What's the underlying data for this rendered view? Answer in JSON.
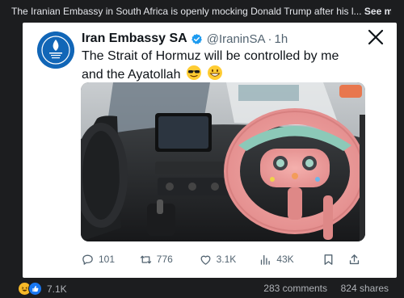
{
  "post": {
    "caption": "The Iranian Embassy in South Africa is openly mocking Donald Trump after his l...",
    "see_more_label": "See more"
  },
  "tweet": {
    "author_name": "Iran Embassy SA",
    "handle": "@IraninSA",
    "separator": "·",
    "time": "1h",
    "text": "The Strait of Hormuz will be controlled by me and the Ayatollah"
  },
  "actions": {
    "replies": "101",
    "retweets": "776",
    "likes": "3.1K",
    "views": "43K"
  },
  "footer": {
    "reaction_count": "7.1K",
    "comments": "283 comments",
    "shares": "824 shares"
  },
  "colors": {
    "verified": "#1d9bf0",
    "avatar": "#1166b7"
  }
}
